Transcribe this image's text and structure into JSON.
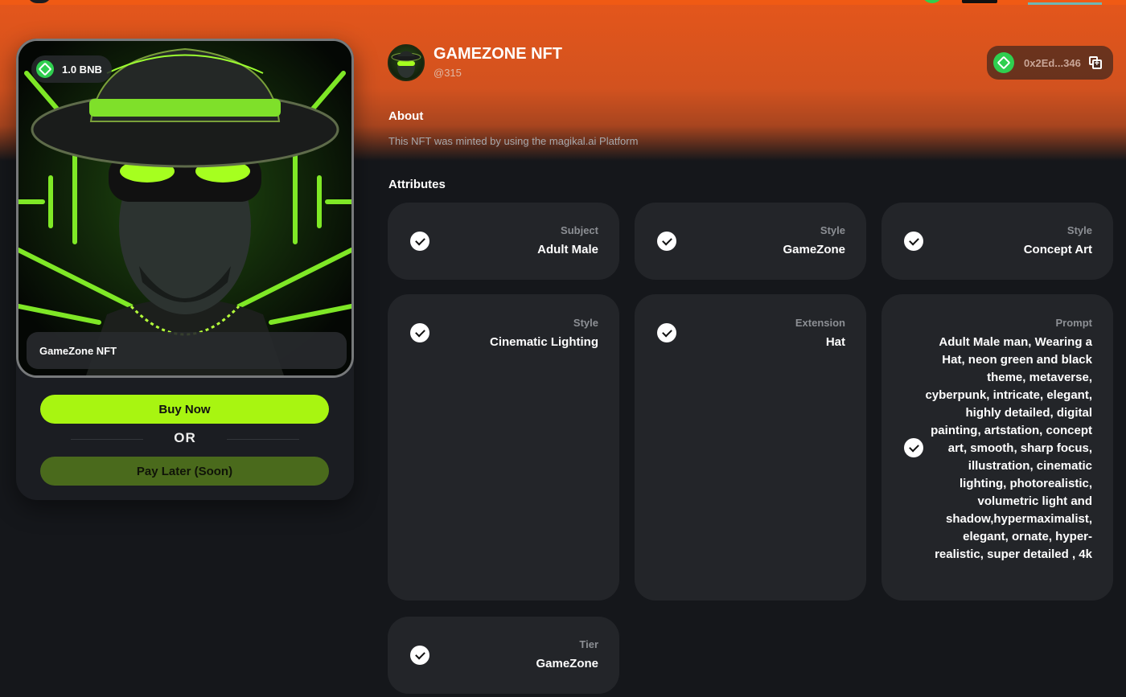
{
  "nft": {
    "price": "1.0 BNB",
    "name_label": "GameZone NFT"
  },
  "actions": {
    "buy_label": "Buy Now",
    "or_label": "OR",
    "later_label": "Pay Later (Soon)"
  },
  "collection": {
    "name": "GAMEZONE NFT",
    "handle": "@315"
  },
  "wallet": {
    "address": "0x2Ed...346",
    "icon": "copy-icon"
  },
  "about": {
    "title": "About",
    "text": "This NFT was minted by using the magikal.ai Platform"
  },
  "attributes": {
    "title": "Attributes",
    "items": [
      {
        "label": "Subject",
        "value": "Adult Male"
      },
      {
        "label": "Style",
        "value": "GameZone"
      },
      {
        "label": "Style",
        "value": "Concept Art"
      },
      {
        "label": "Style",
        "value": "Cinematic Lighting"
      },
      {
        "label": "Extension",
        "value": "Hat"
      },
      {
        "label": "Prompt",
        "value": "Adult Male man, Wearing a Hat, neon green and black theme, metaverse, cyberpunk, intricate, elegant, highly detailed, digital painting, artstation, concept art, smooth, sharp focus, illustration, cinematic lighting, photorealistic, volumetric light and shadow,hypermaximalist, elegant, ornate, hyper-realistic, super detailed , 4k"
      },
      {
        "label": "Tier",
        "value": "GameZone"
      }
    ]
  },
  "colors": {
    "accent": "#a8f511",
    "header_orange": "#e4561b",
    "background": "#15171b",
    "tile": "#232529",
    "coin_green": "#2fcf4f"
  }
}
